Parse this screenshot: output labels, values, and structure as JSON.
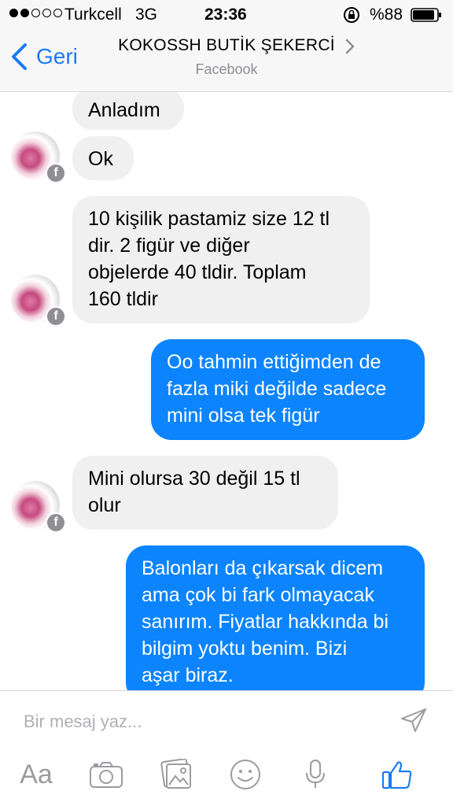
{
  "status_bar": {
    "carrier": "Turkcell",
    "network": "3G",
    "time": "23:36",
    "battery": "%88",
    "signal_bars": 2,
    "icons": [
      "rotation-lock-icon",
      "battery-icon"
    ]
  },
  "nav": {
    "back_label": "Geri",
    "title": "KOKOSSH BUTİK ŞEKERCİ",
    "subtitle": "Facebook",
    "icons": [
      "chevron-left-icon",
      "chevron-right-icon"
    ]
  },
  "messages": [
    {
      "direction": "incoming",
      "text": "Anladım"
    },
    {
      "direction": "incoming",
      "text": "Ok"
    },
    {
      "direction": "incoming",
      "text": "10 kişilik pastamiz size 12 tl\ndir. 2 figür ve diğer\nobjelerde 40 tldir. Toplam\n160 tldir"
    },
    {
      "direction": "outgoing",
      "text": "Oo tahmin ettiğimden de\nfazla miki değilde sadece\nmini olsa tek figür"
    },
    {
      "direction": "incoming",
      "text": "Mini olursa 30 değil 15 tl\nolur"
    },
    {
      "direction": "outgoing",
      "text": "Balonları da çıkarsak dicem\nama çok bi fark olmayacak\nsanırım. Fiyatlar hakkında bi\nbilgim yoktu benim.  Bizi\naşar biraz."
    }
  ],
  "composer": {
    "placeholder": "Bir mesaj yaz...",
    "aa_label": "Aa",
    "tools": [
      "text-format-icon",
      "camera-icon",
      "photos-icon",
      "emoji-icon",
      "microphone-icon",
      "like-thumb-icon"
    ]
  },
  "colors": {
    "accent": "#1a7cf5",
    "outgoing_bubble": "#0b84fe",
    "incoming_bubble": "#f1f0f0",
    "muted": "#8e8e93"
  }
}
